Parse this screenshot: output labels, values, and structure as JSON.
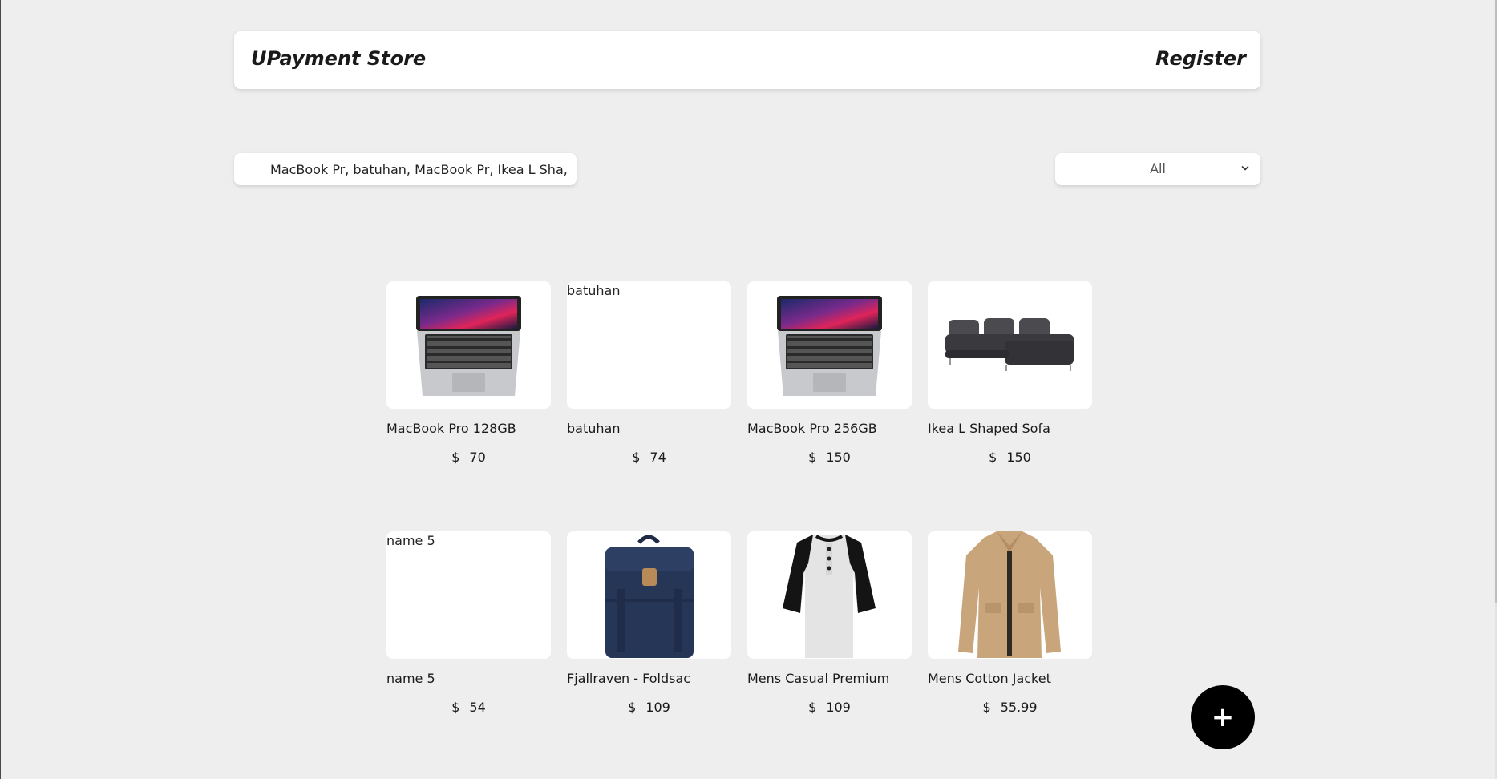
{
  "header": {
    "brand": "UPayment Store",
    "register_label": "Register"
  },
  "filters": {
    "search_value": "MacBook Pr, batuhan, MacBook Pr, Ikea L Sha,",
    "category_selected": "All"
  },
  "products": [
    {
      "name": "MacBook Pro 128GB",
      "currency": "$",
      "price": "70",
      "image": "laptop-image"
    },
    {
      "name": "batuhan",
      "currency": "$",
      "price": "74",
      "image_alt": "batuhan"
    },
    {
      "name": "MacBook Pro 256GB",
      "currency": "$",
      "price": "150",
      "image": "laptop-image"
    },
    {
      "name": "Ikea L Shaped Sofa",
      "currency": "$",
      "price": "150",
      "image": "sofa-image"
    },
    {
      "name": "name 5",
      "currency": "$",
      "price": "54",
      "image_alt": "name 5"
    },
    {
      "name": "Fjallraven - Foldsac",
      "currency": "$",
      "price": "109",
      "image": "backpack-image"
    },
    {
      "name": "Mens Casual Premium",
      "currency": "$",
      "price": "109",
      "image": "tshirt-image"
    },
    {
      "name": "Mens Cotton Jacket",
      "currency": "$",
      "price": "55.99",
      "image": "jacket-image"
    }
  ],
  "fab": {
    "label": "+",
    "icon": "plus-icon"
  }
}
